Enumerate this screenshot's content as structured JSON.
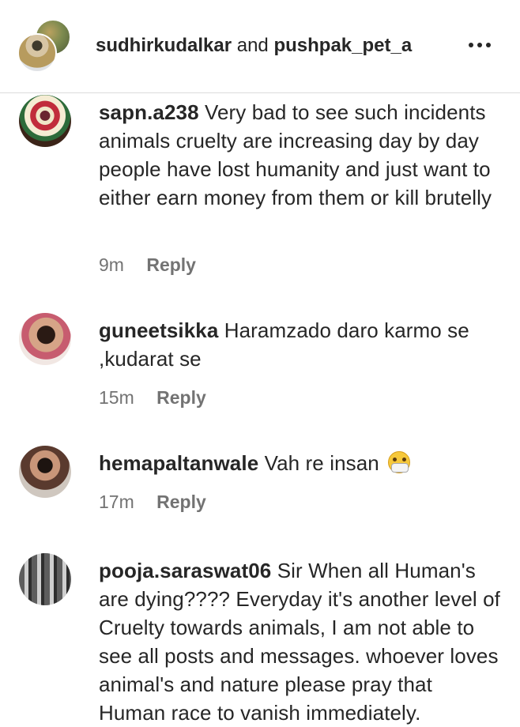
{
  "header": {
    "user1": "sudhirkudalkar",
    "connector": "and",
    "user2": "pushpak_pet_a"
  },
  "comments": [
    {
      "username": "sapn.a238",
      "text": "Very bad to see such incidents animals cruelty are increasing day by day people have lost humanity and just want to either earn money from them or kill brutelly",
      "time": "9m",
      "reply": "Reply"
    },
    {
      "username": "guneetsikka",
      "text": "Haramzado daro karmo se ,kudarat se",
      "time": "15m",
      "reply": "Reply"
    },
    {
      "username": "hemapaltanwale",
      "text": "Vah re insan",
      "emoji": "face-with-mask-emoji",
      "time": "17m",
      "reply": "Reply"
    },
    {
      "username": "pooja.saraswat06",
      "text": "Sir When all Human's are dying???? Everyday it's another level of Cruelty towards animals, I am not able to see all posts and messages. whoever loves animal's and nature please pray that Human race to vanish immediately."
    }
  ]
}
